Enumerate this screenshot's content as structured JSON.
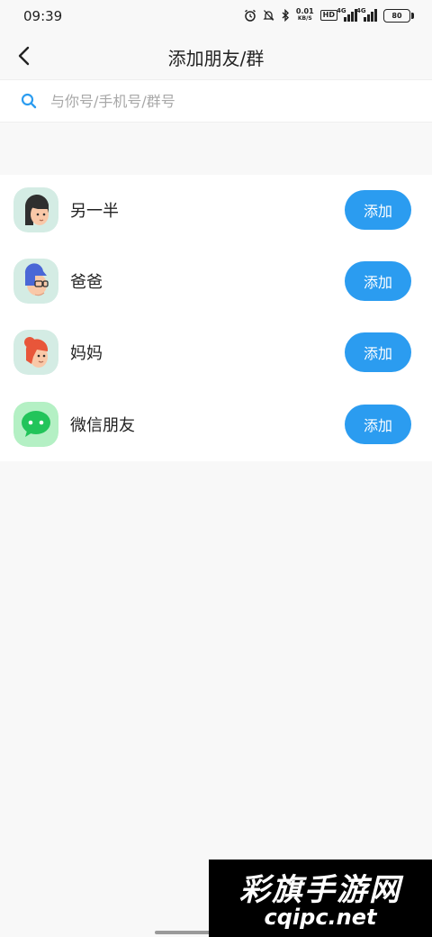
{
  "status_bar": {
    "time": "09:39",
    "net_speed_value": "0.01",
    "net_speed_unit": "KB/S",
    "hd_badge": "HD",
    "signal_1_tag": "4G",
    "signal_2_tag": "4G",
    "battery_level": "80",
    "icons": [
      "alarm-icon",
      "mute-icon",
      "bluetooth-icon"
    ]
  },
  "header": {
    "title": "添加朋友/群",
    "back_icon": "chevron-left-icon"
  },
  "search": {
    "placeholder": "与你号/手机号/群号",
    "value": "",
    "icon": "search-icon"
  },
  "contacts": [
    {
      "name": "另一半",
      "button_label": "添加",
      "avatar_icon": "woman-avatar-icon"
    },
    {
      "name": "爸爸",
      "button_label": "添加",
      "avatar_icon": "man-glasses-avatar-icon"
    },
    {
      "name": "妈妈",
      "button_label": "添加",
      "avatar_icon": "woman-bun-avatar-icon"
    },
    {
      "name": "微信朋友",
      "button_label": "添加",
      "avatar_icon": "wechat-icon"
    }
  ],
  "watermark": {
    "line1": "彩旗手游网",
    "line2": "cqipc.net"
  },
  "colors": {
    "accent": "#2b9cf0",
    "avatar_bg": "#d4ece4",
    "wechat_bg": "#b4f0c4",
    "wechat_green": "#22c45a"
  }
}
